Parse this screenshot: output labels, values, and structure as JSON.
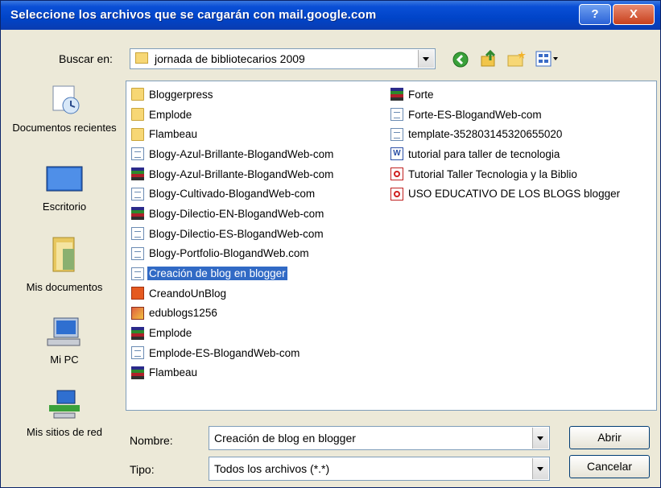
{
  "window": {
    "title": "Seleccione los archivos que se cargarán con mail.google.com"
  },
  "titlebar": {
    "help": "?",
    "close": "X"
  },
  "look_in": {
    "label": "Buscar en:",
    "value": "jornada de bibliotecarios 2009"
  },
  "places": [
    {
      "label": "Documentos recientes",
      "icon": "recent-documents-icon"
    },
    {
      "label": "Escritorio",
      "icon": "desktop-icon"
    },
    {
      "label": "Mis documentos",
      "icon": "my-documents-icon"
    },
    {
      "label": "Mi PC",
      "icon": "my-computer-icon"
    },
    {
      "label": "Mis sitios de red",
      "icon": "network-places-icon"
    }
  ],
  "files_col1": [
    {
      "name": "Bloggerpress",
      "type": "folder"
    },
    {
      "name": "Emplode",
      "type": "folder"
    },
    {
      "name": "Flambeau",
      "type": "folder"
    },
    {
      "name": "Blogy-Azul-Brillante-BlogandWeb-com",
      "type": "doc"
    },
    {
      "name": "Blogy-Azul-Brillante-BlogandWeb-com",
      "type": "rar"
    },
    {
      "name": "Blogy-Cultivado-BlogandWeb-com",
      "type": "doc"
    },
    {
      "name": "Blogy-Dilectio-EN-BlogandWeb-com",
      "type": "rar"
    },
    {
      "name": "Blogy-Dilectio-ES-BlogandWeb-com",
      "type": "doc"
    },
    {
      "name": "Blogy-Portfolio-BlogandWeb.com",
      "type": "doc"
    },
    {
      "name": "Creación de blog en blogger",
      "type": "doc",
      "selected": true
    },
    {
      "name": "CreandoUnBlog",
      "type": "ppt"
    },
    {
      "name": "edublogs1256",
      "type": "img"
    },
    {
      "name": "Emplode",
      "type": "rar"
    },
    {
      "name": "Emplode-ES-BlogandWeb-com",
      "type": "doc"
    },
    {
      "name": "Flambeau",
      "type": "rar"
    }
  ],
  "files_col2": [
    {
      "name": "Forte",
      "type": "rar"
    },
    {
      "name": "Forte-ES-BlogandWeb-com",
      "type": "doc"
    },
    {
      "name": "template-352803145320655020",
      "type": "doc"
    },
    {
      "name": "tutorial para taller de tecnologia",
      "type": "word"
    },
    {
      "name": "Tutorial Taller Tecnologia y la Biblio",
      "type": "pdf"
    },
    {
      "name": "USO EDUCATIVO DE LOS BLOGS blogger",
      "type": "pdf"
    }
  ],
  "filename": {
    "label": "Nombre:",
    "value": "Creación de blog en blogger"
  },
  "filetype": {
    "label": "Tipo:",
    "value": "Todos los archivos (*.*)"
  },
  "buttons": {
    "open": "Abrir",
    "cancel": "Cancelar"
  },
  "word_glyph": "W"
}
